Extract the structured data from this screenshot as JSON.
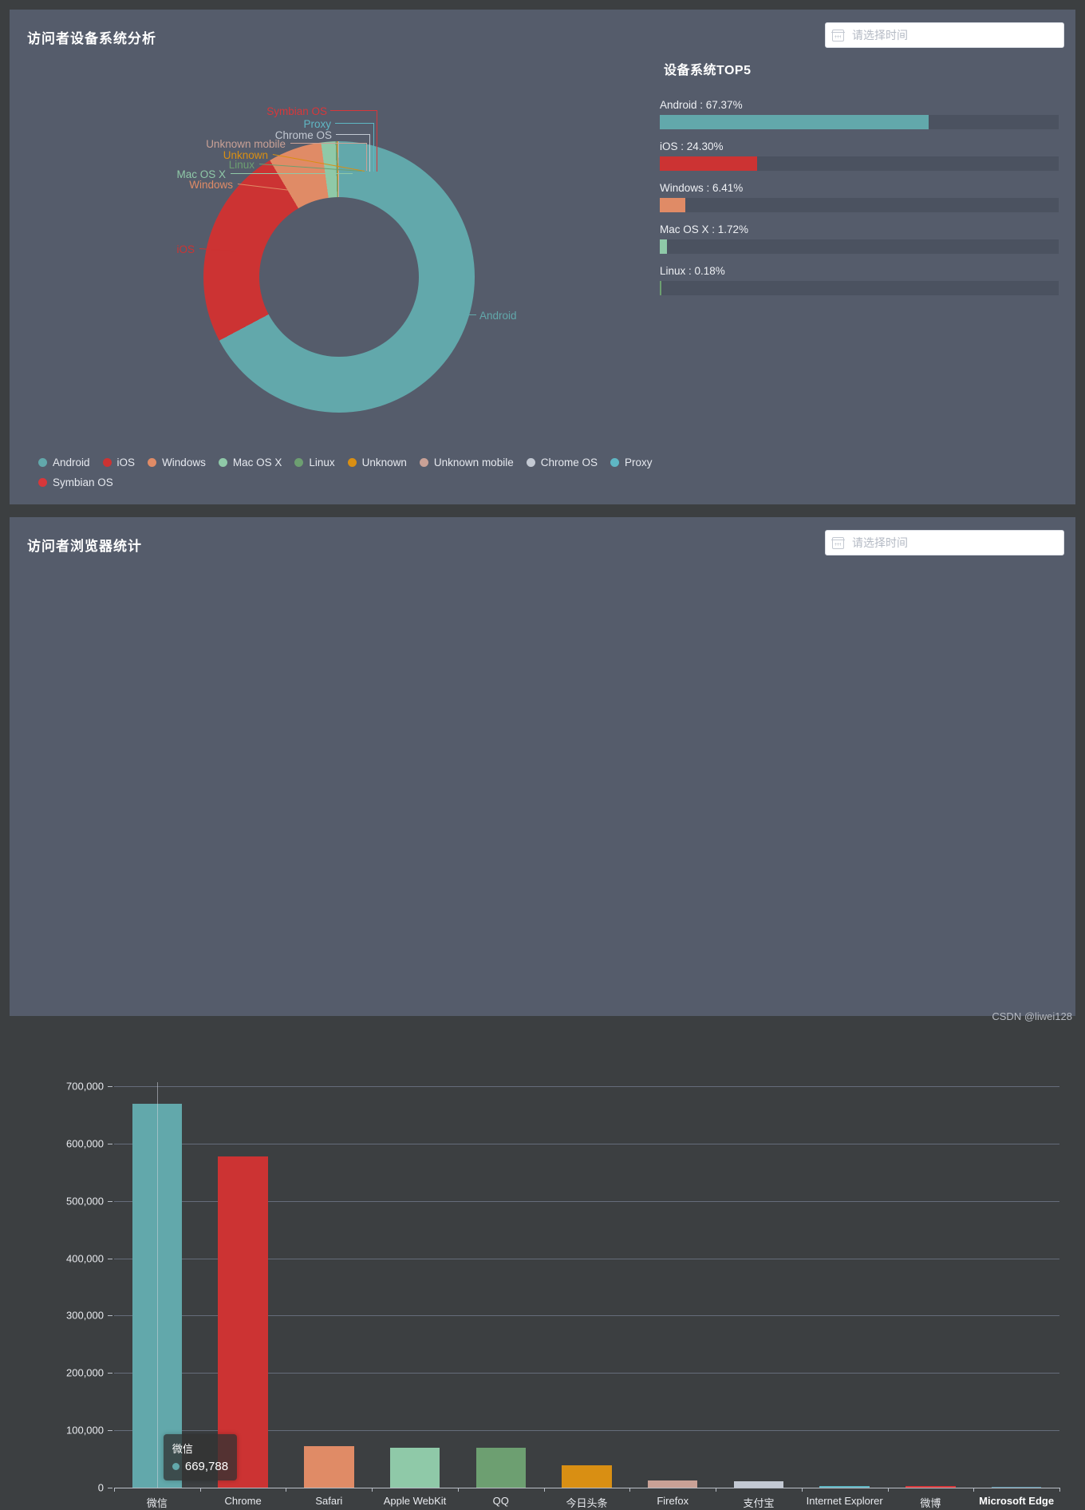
{
  "theme": {
    "page_bg": "#3c3f41",
    "panel_bg": "#555c6b",
    "track_bg": "#4b5260",
    "text": "#e8eaee"
  },
  "panels": {
    "devices": {
      "title": "访问者设备系统分析",
      "datepicker": {
        "placeholder": "请选择时间",
        "icon": "calendar-icon",
        "value": ""
      },
      "top5": {
        "title": "设备系统TOP5",
        "rows": [
          {
            "label": "Android : 67.37%",
            "name": "Android",
            "percent": 67.37,
            "color": "#62a8ab"
          },
          {
            "label": "iOS : 24.30%",
            "name": "iOS",
            "percent": 24.3,
            "color": "#cc3333"
          },
          {
            "label": "Windows : 6.41%",
            "name": "Windows",
            "percent": 6.41,
            "color": "#e08b66"
          },
          {
            "label": "Mac OS X : 1.72%",
            "name": "Mac OS X",
            "percent": 1.72,
            "color": "#8fc9a8"
          },
          {
            "label": "Linux : 0.18%",
            "name": "Linux",
            "percent": 0.18,
            "color": "#6d9f71"
          }
        ]
      },
      "legend": [
        {
          "label": "Android",
          "color": "#62a8ab"
        },
        {
          "label": "iOS",
          "color": "#cc3333"
        },
        {
          "label": "Windows",
          "color": "#e08b66"
        },
        {
          "label": "Mac OS X",
          "color": "#8fc9a8"
        },
        {
          "label": "Linux",
          "color": "#6d9f71"
        },
        {
          "label": "Unknown",
          "color": "#d98f13"
        },
        {
          "label": "Unknown mobile",
          "color": "#c9a196"
        },
        {
          "label": "Chrome OS",
          "color": "#c3c9d3"
        },
        {
          "label": "Proxy",
          "color": "#5fb7c4"
        },
        {
          "label": "Symbian OS",
          "color": "#d8373a"
        }
      ]
    },
    "browsers": {
      "title": "访问者浏览器统计",
      "datepicker": {
        "placeholder": "请选择时间",
        "icon": "calendar-icon",
        "value": ""
      },
      "tooltip": {
        "title": "微信",
        "value": "669,788",
        "dot_color": "#62a8ab"
      }
    }
  },
  "watermark": "CSDN @liwei128",
  "chart_data": [
    {
      "type": "pie",
      "title": "访问者设备系统分析",
      "subtype": "donut",
      "legend_position": "bottom",
      "labels": [
        "Android",
        "iOS",
        "Windows",
        "Mac OS X",
        "Linux",
        "Unknown",
        "Unknown mobile",
        "Chrome OS",
        "Proxy",
        "Symbian OS"
      ],
      "values": [
        67.37,
        24.3,
        6.41,
        1.72,
        0.18,
        0.09,
        0.06,
        0.05,
        0.02,
        0.01
      ],
      "colors": [
        "#62a8ab",
        "#cc3333",
        "#e08b66",
        "#8fc9a8",
        "#6d9f71",
        "#d98f13",
        "#c9a196",
        "#c3c9d3",
        "#5fb7c4",
        "#d8373a"
      ],
      "unit": "%"
    },
    {
      "type": "bar",
      "title": "访问者浏览器统计",
      "xlabel": "",
      "ylabel": "",
      "ylim": [
        0,
        700000
      ],
      "yticks": [
        0,
        100000,
        200000,
        300000,
        400000,
        500000,
        600000,
        700000
      ],
      "ytick_labels": [
        "0",
        "100,000",
        "200,000",
        "300,000",
        "400,000",
        "500,000",
        "600,000",
        "700,000"
      ],
      "grid": true,
      "categories": [
        "微信",
        "Chrome",
        "Safari",
        "Apple WebKit",
        "QQ",
        "今日头条",
        "Firefox",
        "支付宝",
        "Internet Explorer",
        "微博",
        "Microsoft Edge"
      ],
      "values": [
        669788,
        577000,
        73000,
        70000,
        69000,
        39000,
        12000,
        11500,
        2500,
        2200,
        900
      ],
      "colors": [
        "#62a8ab",
        "#cc3333",
        "#e08b66",
        "#8fc9a8",
        "#6d9f71",
        "#d98f13",
        "#c9a196",
        "#c3c9d3",
        "#5fb7c4",
        "#d8373a",
        "#5a94a8"
      ],
      "highlighted_category": "Microsoft Edge"
    }
  ],
  "pie_labels": [
    {
      "text": "Symbian OS",
      "color": "#d8373a"
    },
    {
      "text": "Proxy",
      "color": "#5fb7c4"
    },
    {
      "text": "Chrome OS",
      "color": "#c3c9d3"
    },
    {
      "text": "Unknown mobile",
      "color": "#c9a196"
    },
    {
      "text": "Unknown",
      "color": "#d98f13"
    },
    {
      "text": "Linux",
      "color": "#6d9f71"
    },
    {
      "text": "Mac OS X",
      "color": "#8fc9a8"
    },
    {
      "text": "Windows",
      "color": "#e08b66"
    },
    {
      "text": "iOS",
      "color": "#cc3333"
    },
    {
      "text": "Android",
      "color": "#62a8ab"
    }
  ]
}
